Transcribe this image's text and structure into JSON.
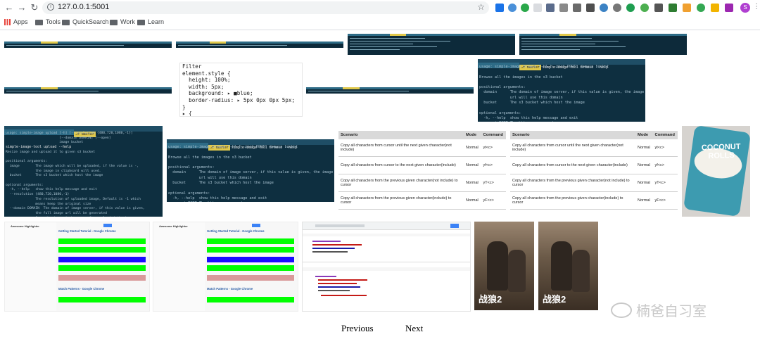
{
  "browser": {
    "url": "127.0.0.1:5001",
    "back_icon": "back-arrow-icon",
    "forward_icon": "forward-arrow-icon",
    "reload_icon": "reload-icon",
    "info_icon": "info-icon",
    "star_icon": "star-icon",
    "avatar_letter": "S",
    "bookmarks": [
      "Apps",
      "Tools",
      "QuickSearch",
      "Work",
      "Learn"
    ],
    "colors": {
      "avatar": "#b03fd1",
      "apps_grid": "#e8453c"
    }
  },
  "gallery": {
    "devtools_text": "Filter\nelement.style {\n  height: 100%;\n  width: 5px;\n  background: ▸ ■blue;\n  border-radius: ▸ 5px 0px 0px 5px;\n}\n▸ {",
    "browse_help_1": "usage: simple-image browse [-h] [--port PORT] domain bucket\n\nBrowse all the images in the s3 bucket\n\npositional arguments:\n  domain      The domain of image server, if this value is given, the image\n              url will use this domain\n  bucket      The s3 bucket which host the image\n\noptional arguments:\n  -h, --help  show this help message and exit\n  --port PORT The http server port",
    "upload_prompt": "simple-image-tool upload --help",
    "upload_help": "usage: simple-image upload [-h] [--resolution {480,720,1080,-1}]\n                           [--domain DOMAIN] [--open]\n                           image bucket\n\nResize image and upload it to given s3 bucket\n\npositional arguments:\n  image        The image which will be uploaded, if the value is -,\n               the image in clipboard will used.\n  bucket       The s3 bucket which host the image\n\noptional arguments:\n  -h, --help   show this help message and exit\n  --resolution {480,720,1080,-1}\n               The resolution of uploaded image, Default is -1 which\n               means keep the original size\n  --domain DOMAIN  The domain of image server, if this value is given,\n               the full image url will be generated\n  --open       Open the image in browser after uploaded the image",
    "browse_prompt": "simple-image-tool browse --help",
    "browse_help_2": "usage: simple-image browse [-h] [--port PORT] domain bucket\n\nBrowse all the images in the s3 bucket\n\npositional arguments:\n  domain      The domain of image server, if this value is given, the image\n              url will use this domain\n  bucket      The s3 bucket which host the image\n\noptional arguments:\n  -h, --help  show this help message and exit\n  --port PORT The http server port",
    "table": {
      "headers": [
        "Scenario",
        "Mode",
        "Command"
      ],
      "rows": [
        [
          "Copy all characters from cursor until the next given character(not include)",
          "Normal",
          "yt<c>"
        ],
        [
          "Copy all characters from cursor to the next given character(include)",
          "Normal",
          "yf<c>"
        ],
        [
          "Copy all characters from the previous given character(not include) to cursor",
          "Normal",
          "yT<c>"
        ],
        [
          "Copy all characters from the previous given character(include) to cursor",
          "Normal",
          "yF<c>"
        ]
      ]
    },
    "coconut_text": "COCONUT ROLLS",
    "highlight_app": "Awesome Highlighter",
    "highlight_title_1": "Getting Started Tutorial - Google Chrome",
    "highlight_title_2": "Match Patterns - Google Chrome",
    "movie_caption": "战狼2"
  },
  "watermark": "楠爸自习室",
  "pager": {
    "previous": "Previous",
    "next": "Next"
  }
}
